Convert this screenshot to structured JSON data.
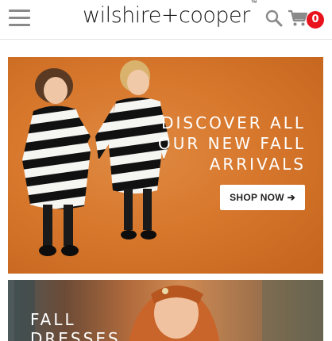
{
  "header": {
    "menu_icon": "hamburger-menu-icon",
    "logo_text": "wilshire+cooper",
    "logo_mark": "™",
    "search_icon": "search-icon",
    "cart_icon": "cart-icon",
    "cart_count": "0",
    "badge_color": "#e8121d"
  },
  "hero": {
    "headline_line1": "DISCOVER ALL",
    "headline_line2": "OUR NEW FALL",
    "headline_line3": "ARRIVALS",
    "button_label": "SHOP NOW ➔",
    "background_color": "#d7782d"
  },
  "promo2": {
    "text_line1": "FALL",
    "text_line2": "DRESSES"
  }
}
